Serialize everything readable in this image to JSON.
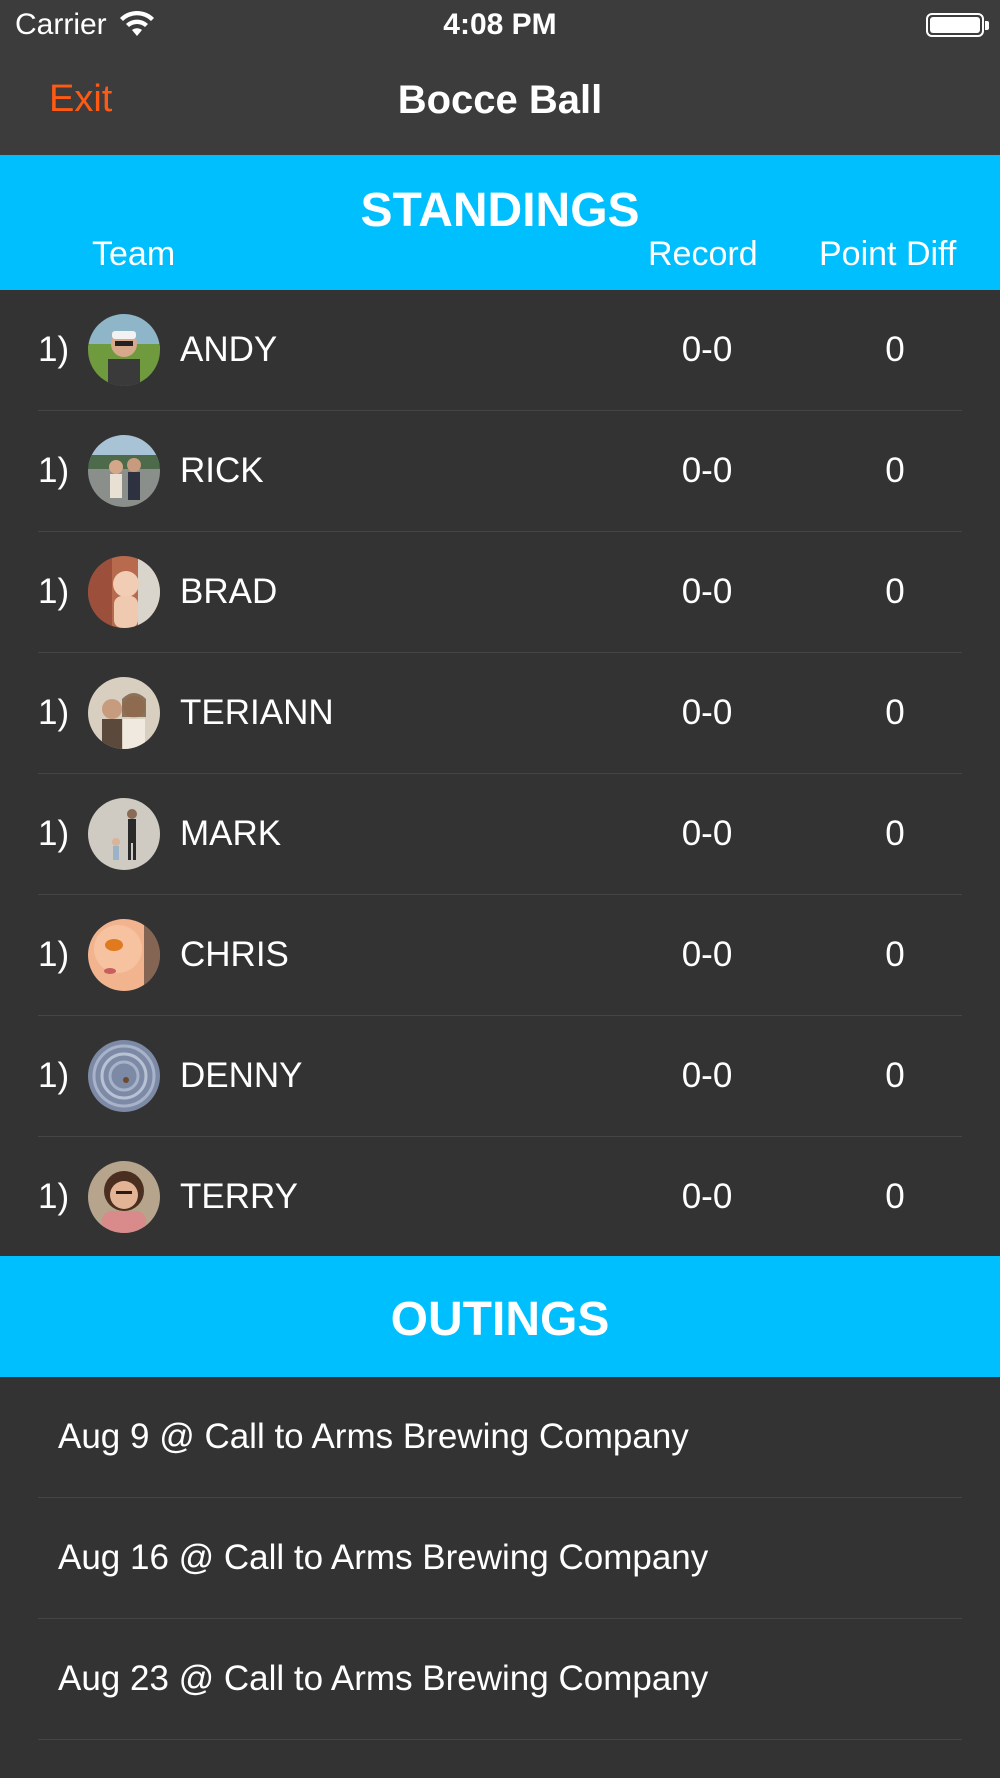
{
  "status_bar": {
    "carrier": "Carrier",
    "time": "4:08 PM",
    "wifi_icon": "wifi-icon",
    "battery_icon": "battery-icon"
  },
  "nav": {
    "exit_label": "Exit",
    "title": "Bocce Ball",
    "exit_color": "#ff5a14"
  },
  "standings": {
    "title": "STANDINGS",
    "columns": {
      "team": "Team",
      "record": "Record",
      "point_diff": "Point Diff"
    },
    "header_color": "#00bfff",
    "rows": [
      {
        "rank": "1)",
        "name": "ANDY",
        "record": "0-0",
        "diff": "0"
      },
      {
        "rank": "1)",
        "name": "RICK",
        "record": "0-0",
        "diff": "0"
      },
      {
        "rank": "1)",
        "name": "BRAD",
        "record": "0-0",
        "diff": "0"
      },
      {
        "rank": "1)",
        "name": "TERIANN",
        "record": "0-0",
        "diff": "0"
      },
      {
        "rank": "1)",
        "name": "MARK",
        "record": "0-0",
        "diff": "0"
      },
      {
        "rank": "1)",
        "name": "CHRIS",
        "record": "0-0",
        "diff": "0"
      },
      {
        "rank": "1)",
        "name": "DENNY",
        "record": "0-0",
        "diff": "0"
      },
      {
        "rank": "1)",
        "name": "TERRY",
        "record": "0-0",
        "diff": "0"
      }
    ]
  },
  "outings": {
    "title": "OUTINGS",
    "items": [
      {
        "label": "Aug 9 @ Call to Arms Brewing Company"
      },
      {
        "label": "Aug 16 @ Call to Arms Brewing Company"
      },
      {
        "label": "Aug 23 @ Call to Arms Brewing Company"
      }
    ]
  }
}
